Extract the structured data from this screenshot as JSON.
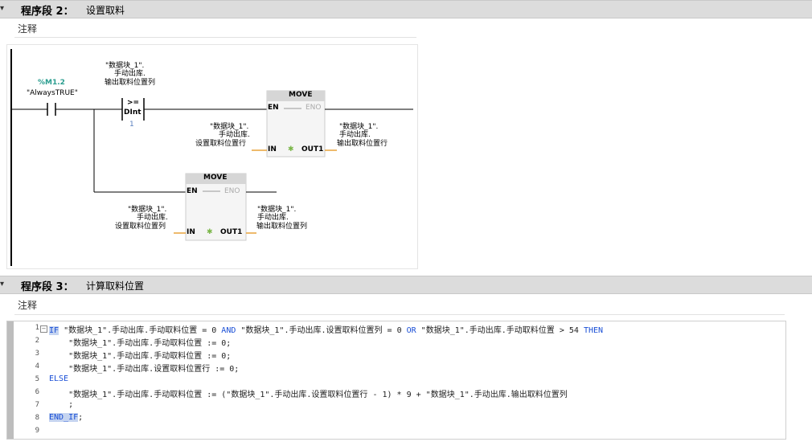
{
  "network2": {
    "title": "程序段 2：",
    "name": "设置取料",
    "comment": "注释",
    "contact": {
      "address": "%M1.2",
      "symbol": "\"AlwaysTRUE\""
    },
    "compare": {
      "operand1_line1": "\"数据块_1\".",
      "operand1_line2": "手动出库.",
      "operand1_line3": "输出取料位置列",
      "op": ">=",
      "type": "DInt",
      "operand2": "1"
    },
    "move1": {
      "title": "MOVE",
      "en": "EN",
      "eno": "ENO",
      "in_label": "IN",
      "out_label": "OUT1",
      "in_l1": "\"数据块_1\".",
      "in_l2": "手动出库.",
      "in_l3": "设置取料位置行",
      "out_l1": "\"数据块_1\".",
      "out_l2": "手动出库.",
      "out_l3": "输出取料位置行"
    },
    "move2": {
      "title": "MOVE",
      "en": "EN",
      "eno": "ENO",
      "in_label": "IN",
      "out_label": "OUT1",
      "in_l1": "\"数据块_1\".",
      "in_l2": "手动出库.",
      "in_l3": "设置取料位置列",
      "out_l1": "\"数据块_1\".",
      "out_l2": "手动出库.",
      "out_l3": "输出取料位置列"
    }
  },
  "network3": {
    "title": "程序段 3：",
    "name": "计算取料位置",
    "comment": "注释",
    "lines": [
      {
        "n": "1",
        "parts": [
          [
            "kwhl",
            "IF"
          ],
          [
            "",
            " \"数据块_1\".手动出库.手动取料位置 = 0 "
          ],
          [
            "kw",
            "AND"
          ],
          [
            "",
            " \"数据块_1\".手动出库.设置取料位置列 = 0 "
          ],
          [
            "kw",
            "OR"
          ],
          [
            "",
            " \"数据块_1\".手动出库.手动取料位置 > 54 "
          ],
          [
            "kw",
            "THEN"
          ]
        ]
      },
      {
        "n": "2",
        "parts": [
          [
            "",
            "    \"数据块_1\".手动出库.手动取料位置 := 0;"
          ]
        ]
      },
      {
        "n": "3",
        "parts": [
          [
            "",
            "    \"数据块_1\".手动出库.手动取料位置 := 0;"
          ]
        ]
      },
      {
        "n": "4",
        "parts": [
          [
            "",
            "    \"数据块_1\".手动出库.设置取料位置行 := 0;"
          ]
        ]
      },
      {
        "n": "5",
        "parts": [
          [
            "kw",
            "ELSE"
          ]
        ]
      },
      {
        "n": "6",
        "parts": [
          [
            "",
            "    \"数据块_1\".手动出库.手动取料位置 := (\"数据块_1\".手动出库.设置取料位置行 - 1) * 9 + \"数据块_1\".手动出库.输出取料位置列"
          ]
        ]
      },
      {
        "n": "7",
        "parts": [
          [
            "",
            "    ;"
          ]
        ]
      },
      {
        "n": "8",
        "parts": [
          [
            "kwhl",
            "END_IF"
          ],
          [
            "",
            ";"
          ]
        ]
      },
      {
        "n": "9",
        "parts": [
          [
            "",
            ""
          ]
        ]
      }
    ]
  },
  "colors": {
    "header_bg": "#dcdcdc",
    "wire": "#000000",
    "orange": "#e8a33a",
    "keyword": "#1a4fd6",
    "tag_green": "#2a9d8f"
  }
}
